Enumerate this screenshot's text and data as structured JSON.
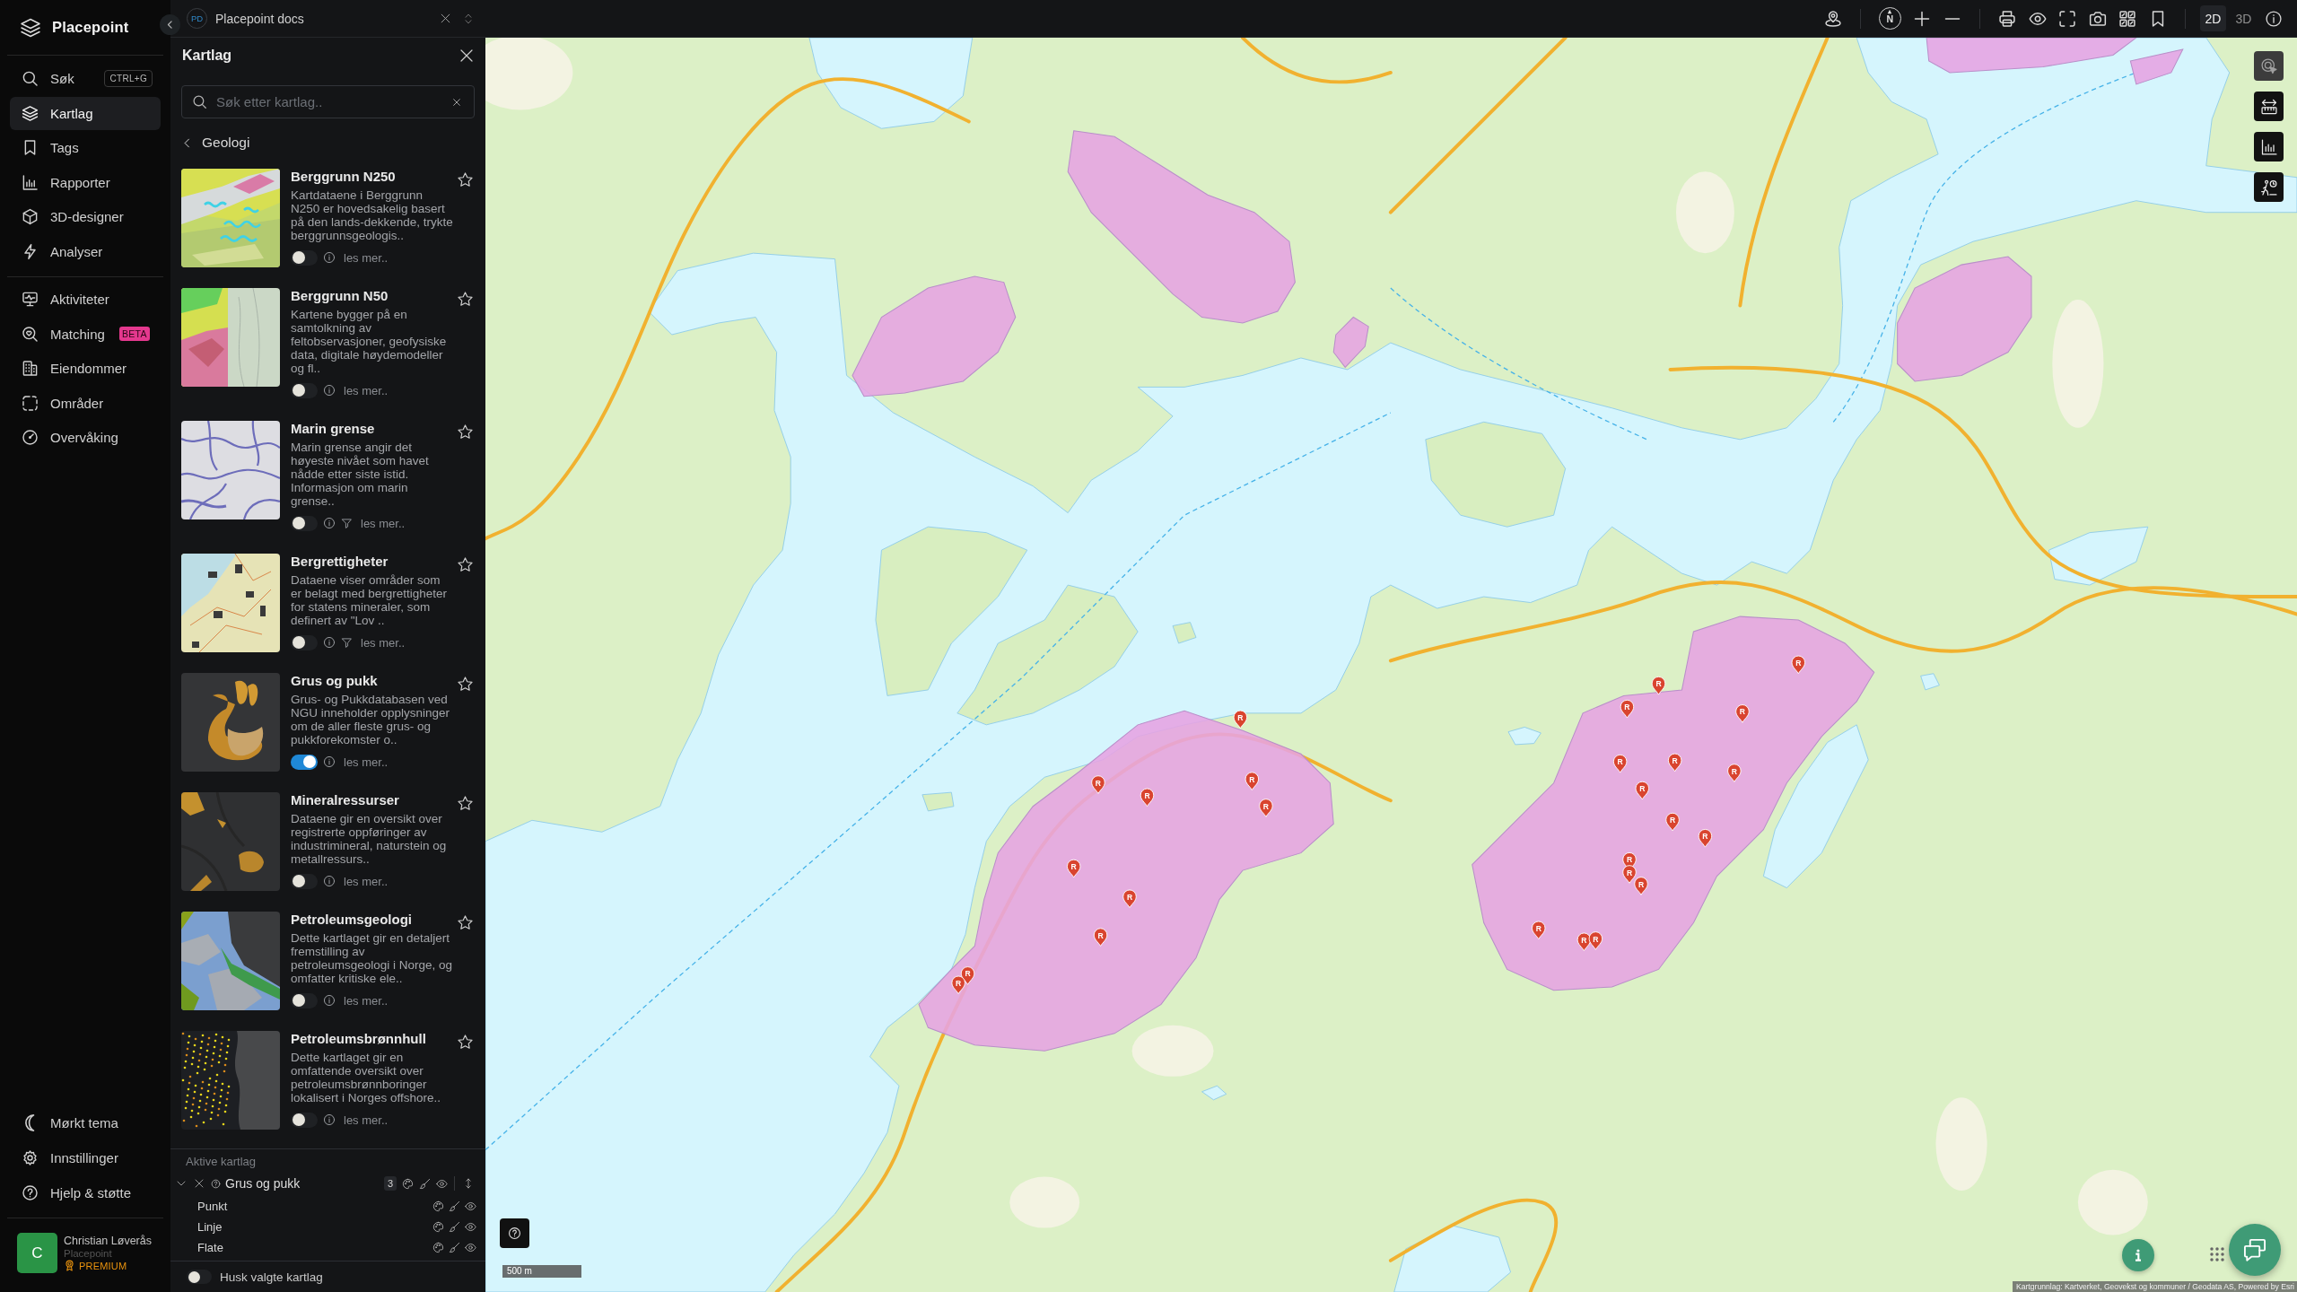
{
  "app": {
    "name": "Placepoint"
  },
  "nav": {
    "main": [
      {
        "label": "Søk",
        "shortcut": "CTRL+G",
        "selected": false
      },
      {
        "label": "Kartlag",
        "selected": true
      },
      {
        "label": "Tags",
        "selected": false
      },
      {
        "label": "Rapporter",
        "selected": false
      },
      {
        "label": "3D-designer",
        "selected": false
      },
      {
        "label": "Analyser",
        "selected": false
      }
    ],
    "secondary": [
      {
        "label": "Aktiviteter",
        "selected": false
      },
      {
        "label": "Matching",
        "badge": "BETA",
        "selected": false
      },
      {
        "label": "Eiendommer",
        "selected": false
      },
      {
        "label": "Områder",
        "selected": false
      },
      {
        "label": "Overvåking",
        "selected": false
      }
    ],
    "footer": [
      {
        "label": "Mørkt tema"
      },
      {
        "label": "Innstillinger"
      },
      {
        "label": "Hjelp & støtte"
      }
    ]
  },
  "user": {
    "initial": "C",
    "name": "Christian Løverås",
    "organization": "Placepoint",
    "plan": "PREMIUM"
  },
  "workspace": {
    "initials": "PD",
    "title": "Placepoint docs"
  },
  "toolbar": {
    "compass": "N",
    "view_modes": [
      {
        "label": "2D",
        "selected": true
      },
      {
        "label": "3D",
        "selected": false
      }
    ]
  },
  "panel": {
    "title": "Kartlag",
    "search": {
      "placeholder": "Søk etter kartlag.."
    },
    "category": "Geologi",
    "layers": [
      {
        "title": "Berggrunn N250",
        "description": "Kartdataene i Berggrunn N250 er hovedsakelig basert på den lands-dekkende, trykte berggrunnsgeologis..",
        "enabled": false,
        "filter": false,
        "favorite": false,
        "link": "les mer.."
      },
      {
        "title": "Berggrunn N50",
        "description": "Kartene bygger på en samtolkning av feltobservasjoner, geofysiske data, digitale høydemodeller og fl..",
        "enabled": false,
        "filter": false,
        "favorite": false,
        "link": "les mer.."
      },
      {
        "title": "Marin grense",
        "description": "Marin grense angir det høyeste nivået som havet nådde etter siste istid. Informasjon om marin grense..",
        "enabled": false,
        "filter": true,
        "favorite": false,
        "link": "les mer.."
      },
      {
        "title": "Bergrettigheter",
        "description": "Dataene viser områder som er belagt med bergrettigheter for statens mineraler, som definert av \"Lov ..",
        "enabled": false,
        "filter": true,
        "favorite": false,
        "link": "les mer.."
      },
      {
        "title": "Grus og pukk",
        "description": "Grus- og Pukkdatabasen ved NGU inneholder opplysninger om de aller fleste grus- og pukkforekomster o..",
        "enabled": true,
        "filter": false,
        "favorite": false,
        "link": "les mer.."
      },
      {
        "title": "Mineralressurser",
        "description": "Dataene gir en oversikt over registrerte oppføringer av industrimineral, naturstein og metallressurs..",
        "enabled": false,
        "filter": false,
        "favorite": false,
        "link": "les mer.."
      },
      {
        "title": "Petroleumsgeologi",
        "description": "Dette kartlaget gir en detaljert fremstilling av petroleumsgeologi i Norge, og omfatter kritiske ele..",
        "enabled": false,
        "filter": false,
        "favorite": false,
        "link": "les mer.."
      },
      {
        "title": "Petroleumsbrønnhull",
        "description": "Dette kartlaget gir en omfattende oversikt over petroleumsbrønnboringer lokalisert i Norges offshore..",
        "enabled": false,
        "filter": false,
        "favorite": false,
        "link": "les mer.."
      }
    ],
    "active": {
      "heading": "Aktive kartlag",
      "groups": [
        {
          "name": "Grus og pukk",
          "count": "3",
          "expanded": true,
          "children": [
            {
              "name": "Punkt"
            },
            {
              "name": "Linje"
            },
            {
              "name": "Flate"
            }
          ]
        }
      ]
    },
    "remember": {
      "label": "Husk valgte kartlag",
      "on": false
    }
  },
  "map": {
    "tools": [
      {
        "disabled": true
      },
      {
        "disabled": false
      },
      {
        "disabled": false
      },
      {
        "disabled": false
      }
    ],
    "markers": [
      {
        "label": "R"
      },
      {
        "label": "R"
      },
      {
        "label": "R"
      },
      {
        "label": "R"
      },
      {
        "label": "R"
      },
      {
        "label": "R"
      },
      {
        "label": "R"
      },
      {
        "label": "R"
      },
      {
        "label": "R"
      },
      {
        "label": "R"
      },
      {
        "label": "R"
      },
      {
        "label": "R"
      },
      {
        "label": "R"
      },
      {
        "label": "R"
      },
      {
        "label": "R"
      },
      {
        "label": "R"
      },
      {
        "label": "R"
      },
      {
        "label": "R"
      },
      {
        "label": "R"
      },
      {
        "label": "R"
      },
      {
        "label": "R"
      },
      {
        "label": "R"
      },
      {
        "label": "R"
      },
      {
        "label": "R"
      },
      {
        "label": "R"
      },
      {
        "label": "R"
      }
    ],
    "scale": "500 m",
    "attribution": "Kartgrunnlag: Kartverket, Geovekst og kommuner / Geodata AS, Powered by Esri"
  }
}
